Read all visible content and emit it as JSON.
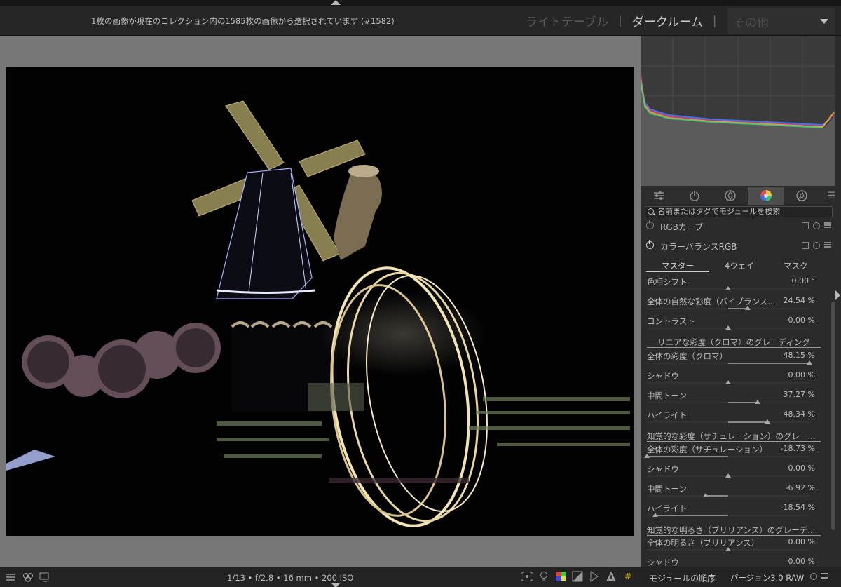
{
  "header": {
    "selection_info": "1枚の画像が現在のコレクション内の1585枚の画像から選択されています (#1582)",
    "views": [
      "ライトテーブル",
      "ダークルーム"
    ],
    "active_view": "ダークルーム",
    "other_dropdown": "その他"
  },
  "right_panel": {
    "search_placeholder": "名前またはタグでモジュールを検索",
    "module_tab_icons": [
      "sliders-icon",
      "power-icon",
      "shutter-icon",
      "color-wheel-icon",
      "aperture-icon"
    ],
    "modules": {
      "rgb_curve": "RGBカーブ",
      "color_balance_rgb": "カラーバランスRGB"
    },
    "cb_tabs": [
      "マスター",
      "4ウェイ",
      "マスク"
    ],
    "sliders": [
      {
        "label": "色相シフト",
        "value": "0.00 °",
        "fraction": 0.5
      },
      {
        "label": "全体の自然な彩度（バイブランス...",
        "value": "24.54 %",
        "fraction": 0.62
      },
      {
        "label": "コントラスト",
        "value": "0.00 %",
        "fraction": 0.5
      }
    ],
    "section_linear": "リニアな彩度（クロマ）のグレーディング",
    "chroma_sliders": [
      {
        "label": "全体の彩度（クロマ）",
        "value": "48.15 %",
        "fraction": 1.0
      },
      {
        "label": "シャドウ",
        "value": "0.00 %",
        "fraction": 0.5
      },
      {
        "label": "中間トーン",
        "value": "37.27 %",
        "fraction": 0.68
      },
      {
        "label": "ハイライト",
        "value": "48.34 %",
        "fraction": 0.74
      }
    ],
    "section_saturation": "知覚的な彩度（サチュレーション）のグレー...",
    "saturation_sliders": [
      {
        "label": "全体の彩度（サチュレーション）",
        "value": "-18.73 %",
        "fraction": 0.0
      },
      {
        "label": "シャドウ",
        "value": "0.00 %",
        "fraction": 0.5
      },
      {
        "label": "中間トーン",
        "value": "-6.92 %",
        "fraction": 0.36
      },
      {
        "label": "ハイライト",
        "value": "-18.54 %",
        "fraction": 0.05
      }
    ],
    "section_brilliance": "知覚的な明るさ（ブリリアンス）のグレーデ...",
    "brilliance_sliders": [
      {
        "label": "全体の明るさ（ブリリアンス）",
        "value": "0.00 %",
        "fraction": 0.5
      },
      {
        "label": "シャドウ",
        "value": "0.00 %",
        "fraction": 0.5
      }
    ]
  },
  "bottom": {
    "exif": "1/13 • f/2.8 • 16 mm • 200 ISO",
    "module_order": "モジュールの順序",
    "version": "バージョン3.0 RAW"
  },
  "colors": {
    "background": "#777777",
    "panel": "#2b2b2b",
    "header": "#262626"
  }
}
